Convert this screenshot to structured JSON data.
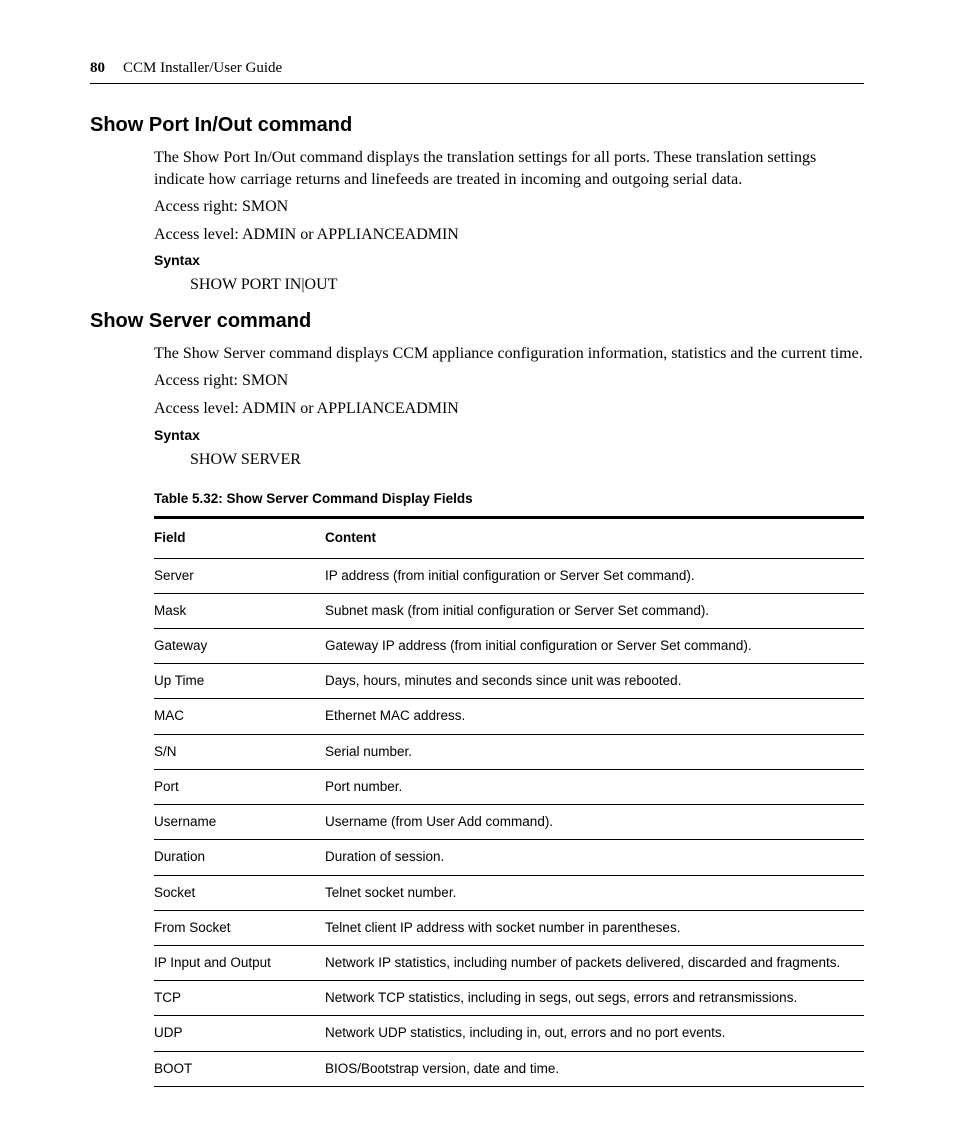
{
  "header": {
    "page_number": "80",
    "guide_title": "CCM Installer/User Guide"
  },
  "section1": {
    "heading": "Show Port In/Out command",
    "para1": "The Show Port In/Out command displays the translation settings for all ports. These translation settings indicate how carriage returns and linefeeds are treated in incoming and outgoing serial data.",
    "access_right": "Access right: SMON",
    "access_level": "Access level: ADMIN or APPLIANCEADMIN",
    "syntax_label": "Syntax",
    "syntax_line": "SHOW PORT IN|OUT"
  },
  "section2": {
    "heading": "Show Server command",
    "para1": "The Show Server command displays CCM appliance configuration information, statistics and the current time.",
    "access_right": "Access right: SMON",
    "access_level": "Access level: ADMIN or APPLIANCEADMIN",
    "syntax_label": "Syntax",
    "syntax_line": "SHOW SERVER"
  },
  "table": {
    "caption": "Table 5.32: Show Server Command Display Fields",
    "head_field": "Field",
    "head_content": "Content",
    "rows": [
      {
        "field": "Server",
        "content": "IP address (from initial configuration or Server Set command)."
      },
      {
        "field": "Mask",
        "content": "Subnet mask (from initial configuration or Server Set command)."
      },
      {
        "field": "Gateway",
        "content": "Gateway IP address (from initial configuration or Server Set command)."
      },
      {
        "field": "Up Time",
        "content": "Days, hours, minutes and seconds since unit was rebooted."
      },
      {
        "field": "MAC",
        "content": "Ethernet MAC address."
      },
      {
        "field": "S/N",
        "content": "Serial number."
      },
      {
        "field": "Port",
        "content": "Port number."
      },
      {
        "field": "Username",
        "content": "Username (from User Add command)."
      },
      {
        "field": "Duration",
        "content": "Duration of session."
      },
      {
        "field": "Socket",
        "content": "Telnet socket number."
      },
      {
        "field": "From Socket",
        "content": "Telnet client IP address with socket number in parentheses."
      },
      {
        "field": "IP Input and Output",
        "content": "Network IP statistics, including number of packets delivered, discarded and fragments."
      },
      {
        "field": "TCP",
        "content": "Network TCP statistics, including in segs, out segs, errors and retransmissions."
      },
      {
        "field": "UDP",
        "content": "Network UDP statistics, including in, out, errors and no port events."
      },
      {
        "field": "BOOT",
        "content": "BIOS/Bootstrap version, date and time."
      }
    ]
  }
}
